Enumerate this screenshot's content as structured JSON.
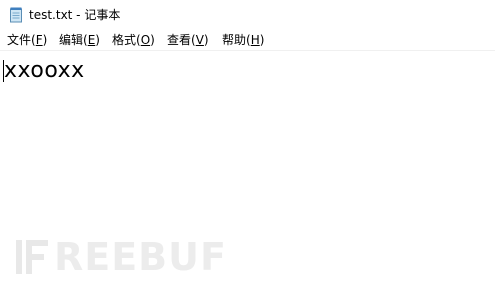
{
  "window": {
    "title": "test.txt - 记事本",
    "icon": "notepad-icon"
  },
  "menu": {
    "items": [
      {
        "label": "文件",
        "accel": "F"
      },
      {
        "label": "编辑",
        "accel": "E"
      },
      {
        "label": "格式",
        "accel": "O"
      },
      {
        "label": "查看",
        "accel": "V"
      },
      {
        "label": "帮助",
        "accel": "H"
      }
    ]
  },
  "editor": {
    "content": "xxooxx"
  },
  "watermark": {
    "text": "REEBUF",
    "logo": "freebuf-logo-icon"
  }
}
